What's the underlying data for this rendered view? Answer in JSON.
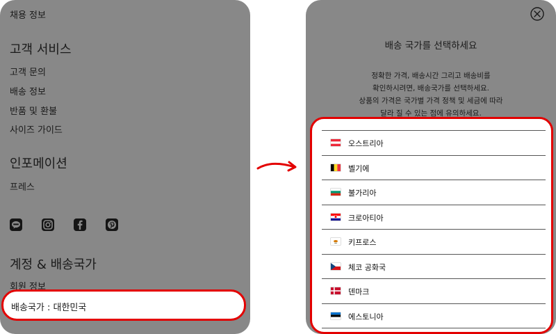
{
  "left_menu": {
    "top_link": "채용 정보",
    "customer_service": {
      "title": "고객 서비스",
      "items": [
        "고객 문의",
        "배송 정보",
        "반품 및 환불",
        "사이즈 가이드"
      ]
    },
    "information": {
      "title": "인포메이션",
      "items": [
        "프레스"
      ]
    },
    "social_icons": [
      "kakaotalk-icon",
      "instagram-icon",
      "facebook-icon",
      "pinterest-icon"
    ],
    "account": {
      "title": "계정 & 배송국가",
      "items": [
        "회원 정보"
      ]
    },
    "shipping_country": "배송국가 : 대한민국"
  },
  "modal": {
    "title": "배송 국가를 선택하세요",
    "description_lines": [
      "정확한 가격, 배송시간 그리고 배송비를",
      "확인하시려면, 배송국가를 선택하세요.",
      "상품의 가격은 국가별 가격 정책 및 세금에 따라",
      "달라 질 수 있는 점에 유의하세요."
    ],
    "countries": [
      {
        "name": "오스트리아",
        "flag": "austria"
      },
      {
        "name": "벨기에",
        "flag": "belgium"
      },
      {
        "name": "불가리아",
        "flag": "bulgaria"
      },
      {
        "name": "크로아티아",
        "flag": "croatia"
      },
      {
        "name": "키프로스",
        "flag": "cyprus"
      },
      {
        "name": "체코 공화국",
        "flag": "czech"
      },
      {
        "name": "덴마크",
        "flag": "denmark"
      },
      {
        "name": "에스토니아",
        "flag": "estonia"
      }
    ]
  },
  "colors": {
    "overlay": "#888888",
    "highlight": "#e30000"
  }
}
